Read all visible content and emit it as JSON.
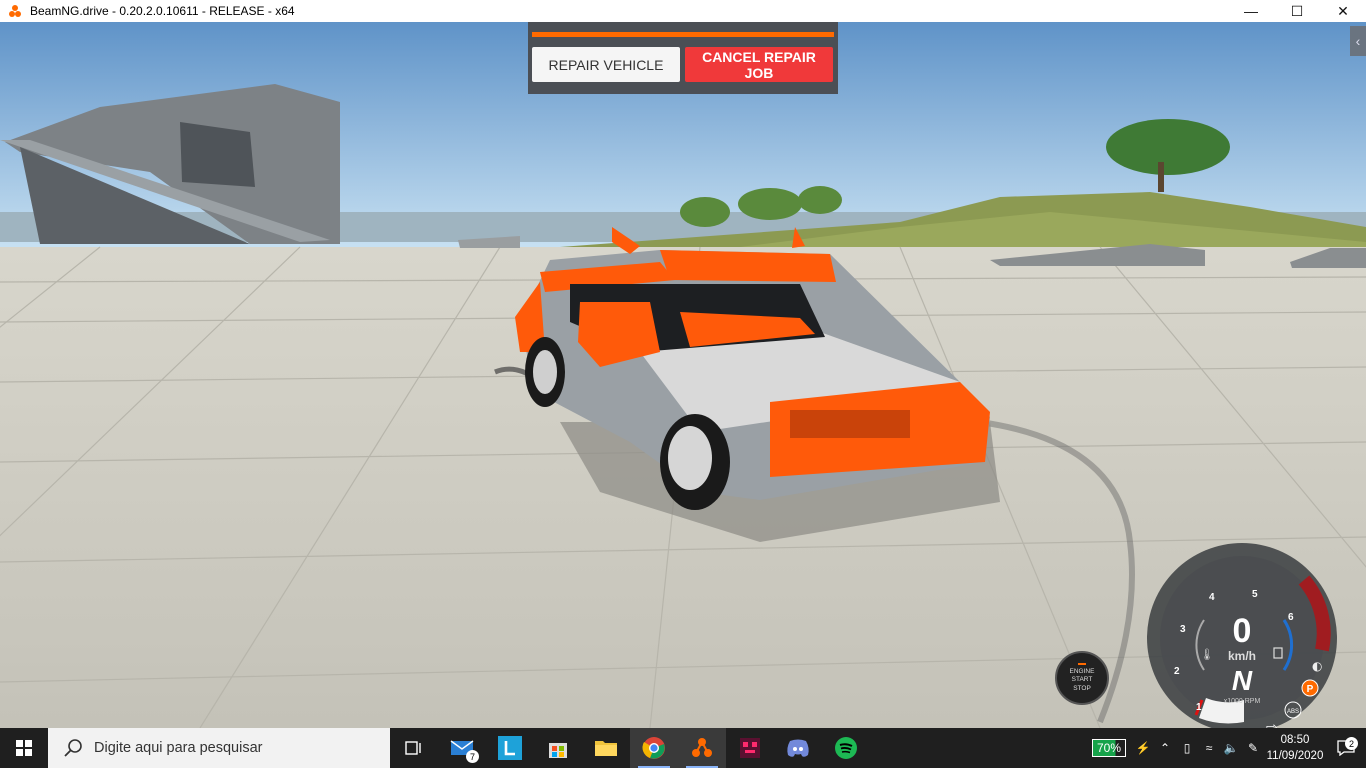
{
  "window": {
    "title": "BeamNG.drive - 0.20.2.0.10611 - RELEASE - x64"
  },
  "repair": {
    "repair_label": "REPAIR VEHICLE",
    "cancel_label": "CANCEL REPAIR JOB",
    "progress": 1.0
  },
  "engine_button": {
    "line1": "ENGINE",
    "line2": "START",
    "line3": "STOP"
  },
  "dashboard": {
    "speed": "0",
    "speed_unit": "km/h",
    "gear": "N",
    "rpm_unit": "x1000 RPM",
    "rpm_ticks": [
      "1",
      "2",
      "3",
      "4",
      "5",
      "6"
    ],
    "parking_label": "P",
    "abs_label": "ABS"
  },
  "taskbar": {
    "search_placeholder": "Digite aqui para pesquisar",
    "mail_badge": "7",
    "battery": "70%",
    "time": "08:50",
    "date": "11/09/2020",
    "notifications": "2"
  },
  "colors": {
    "accent": "#ff6a00",
    "cancel": "#f0393a",
    "car_orange": "#ff5a0a"
  }
}
